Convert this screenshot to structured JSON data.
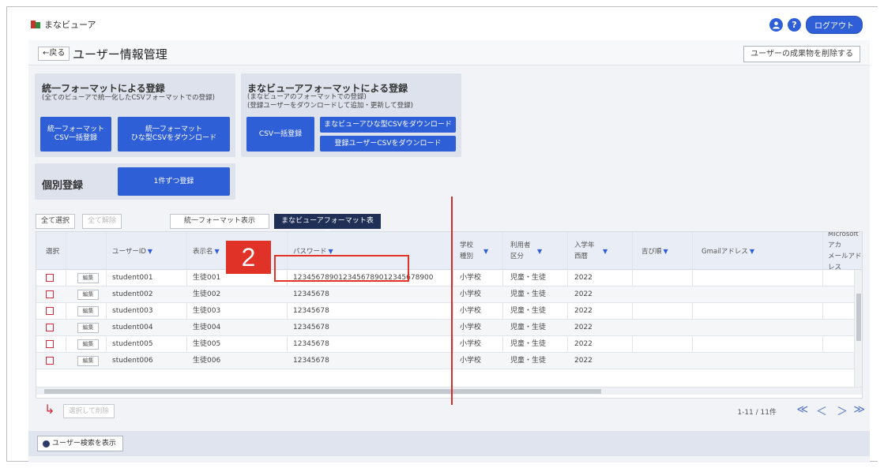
{
  "app": {
    "name": "まなビューア"
  },
  "top": {
    "user_icon": "?",
    "help_icon": "?",
    "logout": "ログアウト"
  },
  "header": {
    "back": "←戻る",
    "title": "ユーザー情報管理",
    "delete_results": "ユーザーの成果物を削除する"
  },
  "unified": {
    "title": "統一フォーマットによる登録",
    "subtitle": "(全てのビューアで統一化したCSVフォーマットでの登録)",
    "btn_bulk": "統一フォーマット\nCSV一括登録",
    "btn_template": "統一フォーマット\nひな型CSVをダウンロード"
  },
  "manaviewer": {
    "title": "まなビューアフォーマットによる登録",
    "subtitle1": "(まなビューアのフォーマットでの登録)",
    "subtitle2": "(登録ユーザーをダウンロードして追加・更新して登録)",
    "btn_bulk": "CSV一括登録",
    "btn_template": "まなビューアひな型CSVをダウンロード",
    "btn_users": "登録ユーザーCSVをダウンロード"
  },
  "individual": {
    "title": "個別登録",
    "btn": "1件ずつ登録"
  },
  "toolbar": {
    "select_all": "全て選択",
    "deselect_all": "全て解除",
    "unified_view": "統一フォーマット表示",
    "mana_view": "まなビューアフォーマット表示"
  },
  "table": {
    "headers": {
      "select": "選択",
      "userid": "ユーザーID",
      "display": "表示名",
      "password": "パスワード",
      "school1": "学校",
      "school2": "種別",
      "user1": "利用者",
      "user2": "区分",
      "year1": "入学年",
      "year2": "西暦",
      "chars": "吉び順",
      "gmail": "Gmailアドレス",
      "ms1": "Microsoftアカ",
      "ms2": "メールアドレス"
    },
    "edit_label": "編集",
    "rows": [
      {
        "id": "student001",
        "name": "生徒001",
        "password": "1234567890123456789012345678900",
        "school": "小学校",
        "user_type": "児童・生徒",
        "year": "2022"
      },
      {
        "id": "student002",
        "name": "生徒002",
        "password": "12345678",
        "school": "小学校",
        "user_type": "児童・生徒",
        "year": "2022"
      },
      {
        "id": "student003",
        "name": "生徒003",
        "password": "12345678",
        "school": "小学校",
        "user_type": "児童・生徒",
        "year": "2022"
      },
      {
        "id": "student004",
        "name": "生徒004",
        "password": "12345678",
        "school": "小学校",
        "user_type": "児童・生徒",
        "year": "2022"
      },
      {
        "id": "student005",
        "name": "生徒005",
        "password": "12345678",
        "school": "小学校",
        "user_type": "児童・生徒",
        "year": "2022"
      },
      {
        "id": "student006",
        "name": "生徒006",
        "password": "12345678",
        "school": "小学校",
        "user_type": "児童・生徒",
        "year": "2022"
      }
    ]
  },
  "pager": {
    "bulk_delete": "選択して削除",
    "info": "1-11 / 11件",
    "first": "≪",
    "prev": "＜",
    "next": "＞",
    "last": "≫"
  },
  "search": {
    "toggle": "ユーザー検索を表示"
  },
  "annotation": {
    "callout": "2"
  },
  "colors": {
    "primary": "#2f5fd7",
    "dark_tab": "#1f2f55",
    "annotation_red": "#e13227"
  }
}
